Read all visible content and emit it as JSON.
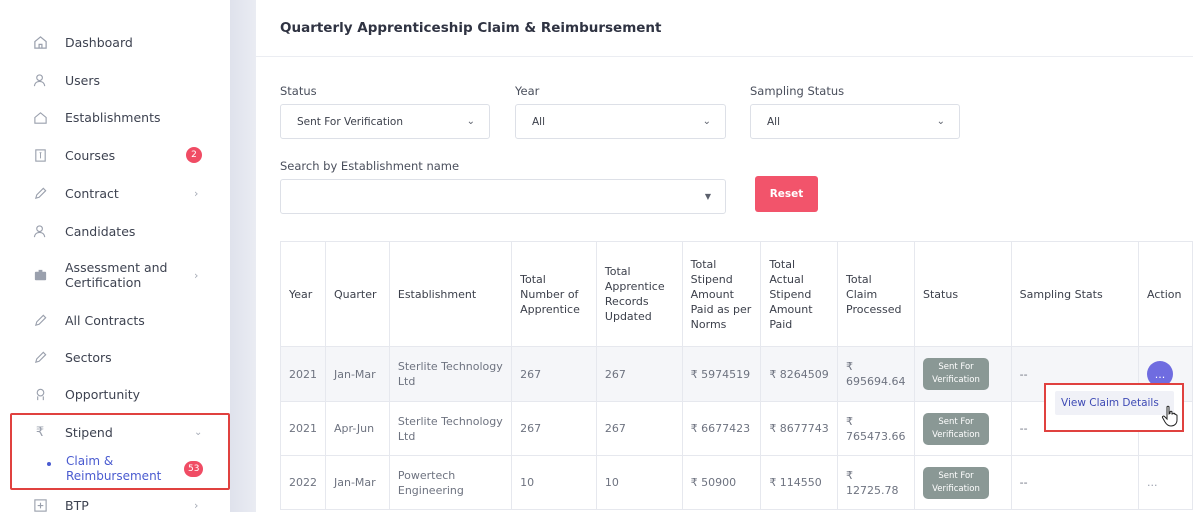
{
  "sidebar": {
    "items": [
      {
        "label": "Dashboard",
        "icon": "home-icon"
      },
      {
        "label": "Users",
        "icon": "users-icon"
      },
      {
        "label": "Establishments",
        "icon": "building-icon"
      },
      {
        "label": "Courses",
        "icon": "book-icon",
        "badge": "2"
      },
      {
        "label": "Contract",
        "icon": "pen-icon"
      },
      {
        "label": "Candidates",
        "icon": "candidates-icon"
      },
      {
        "label": "Assessment and Certification",
        "icon": "certificate-icon"
      },
      {
        "label": "All Contracts",
        "icon": "pen-icon"
      },
      {
        "label": "Sectors",
        "icon": "pen-icon"
      },
      {
        "label": "Opportunity",
        "icon": "opportunity-icon"
      },
      {
        "label": "Stipend",
        "icon": "rupee-icon"
      },
      {
        "label": "BTP",
        "icon": "plus-box-icon"
      }
    ],
    "sub_item": {
      "label": "Claim & Reimbursement",
      "badge": "53"
    }
  },
  "page": {
    "title": "Quarterly Apprenticeship Claim & Reimbursement"
  },
  "filters": {
    "status_label": "Status",
    "status_value": "Sent For Verification",
    "year_label": "Year",
    "year_value": "All",
    "sampling_label": "Sampling Status",
    "sampling_value": "All",
    "search_label": "Search by Establishment name",
    "search_value": "",
    "reset_label": "Reset"
  },
  "table": {
    "headers": [
      "Year",
      "Quarter",
      "Establishment",
      "Total Number of Apprentice",
      "Total Apprentice Records Updated",
      "Total Stipend Amount Paid as per Norms",
      "Total Actual Stipend Amount Paid",
      "Total Claim Processed",
      "Status",
      "Sampling Stats",
      "Action"
    ],
    "rows": [
      [
        "2021",
        "Jan-Mar",
        "Sterlite Technology Ltd",
        "267",
        "267",
        "₹ 5974519",
        "₹ 8264509",
        "₹ 695694.64",
        "Sent For Verification",
        "--",
        "..."
      ],
      [
        "2021",
        "Apr-Jun",
        "Sterlite Technology Ltd",
        "267",
        "267",
        "₹ 6677423",
        "₹ 8677743",
        "₹ 765473.66",
        "Sent For Verification",
        "--",
        ""
      ],
      [
        "2022",
        "Jan-Mar",
        "Powertech Engineering",
        "10",
        "10",
        "₹ 50900",
        "₹ 114550",
        "₹ 12725.78",
        "Sent For Verification",
        "--",
        "..."
      ]
    ]
  },
  "action_menu": {
    "item_label": "View Claim Details"
  },
  "colors": {
    "accent": "#6f6ce0",
    "reset": "#f2546b",
    "badge": "#f04c64",
    "highlight": "#e0413f",
    "status_pill": "#8a9895"
  }
}
